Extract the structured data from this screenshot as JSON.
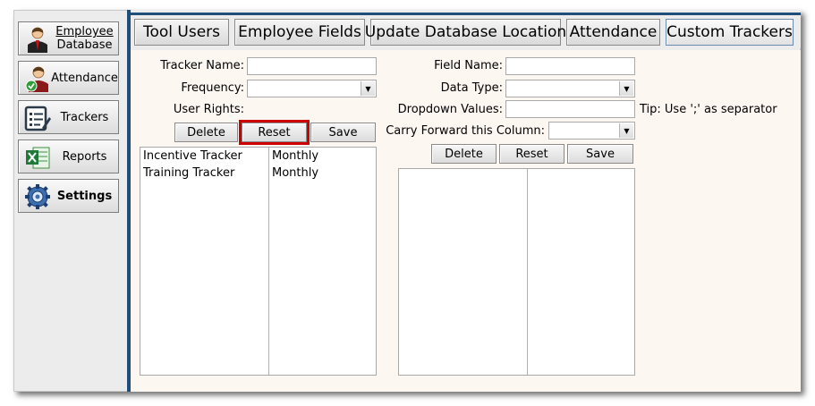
{
  "sidebar": {
    "items": [
      {
        "label_line1": "Employee",
        "label_line2": "Database",
        "icon": "employee-database-icon"
      },
      {
        "label": "Attendance",
        "icon": "attendance-icon"
      },
      {
        "label": "Trackers",
        "icon": "trackers-icon"
      },
      {
        "label": "Reports",
        "icon": "reports-icon"
      },
      {
        "label": "Settings",
        "icon": "settings-icon"
      }
    ]
  },
  "tabs": [
    {
      "label": "Tool Users"
    },
    {
      "label": "Employee Fields"
    },
    {
      "label": "Update Database Location"
    },
    {
      "label": "Attendance"
    },
    {
      "label": "Custom Trackers"
    }
  ],
  "tracker_form": {
    "tracker_name_label": "Tracker Name:",
    "tracker_name_value": "",
    "frequency_label": "Frequency:",
    "frequency_value": "",
    "user_rights_label": "User Rights:",
    "delete_label": "Delete",
    "reset_label": "Reset",
    "save_label": "Save",
    "list": {
      "rows": [
        {
          "name": "Incentive Tracker",
          "frequency": "Monthly"
        },
        {
          "name": "Training Tracker",
          "frequency": "Monthly"
        }
      ]
    }
  },
  "field_form": {
    "field_name_label": "Field Name:",
    "field_name_value": "",
    "data_type_label": "Data Type:",
    "data_type_value": "",
    "dropdown_values_label": "Dropdown Values:",
    "dropdown_values_value": "",
    "tip": "Tip: Use ';' as separator",
    "carry_forward_label": "Carry Forward this Column:",
    "carry_forward_value": "",
    "delete_label": "Delete",
    "reset_label": "Reset",
    "save_label": "Save"
  },
  "colors": {
    "accent": "#1f4e79",
    "content_bg": "#fdf7f2",
    "highlight": "#cc0000"
  }
}
